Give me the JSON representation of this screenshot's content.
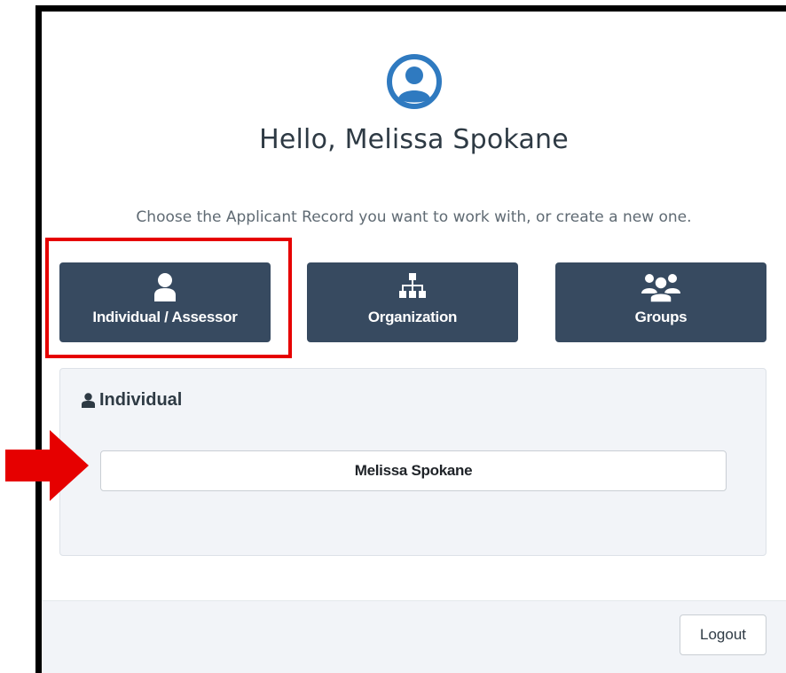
{
  "greeting": "Hello, Melissa Spokane",
  "instructions": "Choose the Applicant Record you want to work with, or create a new one.",
  "record_types": [
    {
      "label": "Individual / Assessor",
      "icon": "user-icon"
    },
    {
      "label": "Organization",
      "icon": "sitemap-icon"
    },
    {
      "label": "Groups",
      "icon": "users-icon"
    }
  ],
  "panel": {
    "title": "Individual",
    "title_icon": "user-icon",
    "records": [
      "Melissa Spokane"
    ]
  },
  "footer": {
    "logout_label": "Logout"
  },
  "colors": {
    "button_bg": "#374a60",
    "accent_blue": "#2f7ac0",
    "highlight_red": "#e60000",
    "panel_bg": "#f2f4f8"
  }
}
